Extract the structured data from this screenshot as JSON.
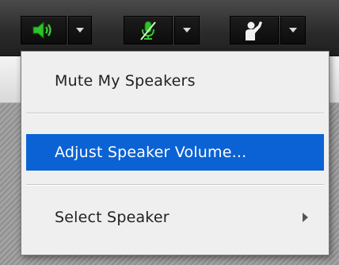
{
  "toolbar": {
    "speaker_icon": "speaker-icon",
    "microphone_icon": "microphone-muted-icon",
    "raise_hand_icon": "raise-hand-icon",
    "dropdown_icon": "chevron-down-icon",
    "accent_color": "#35c82e"
  },
  "menu": {
    "items": [
      {
        "label": "Mute My Speakers"
      },
      {
        "label": "Adjust Speaker Volume..."
      },
      {
        "label": "Select Speaker"
      }
    ],
    "selected_index": 1,
    "selection_color": "#0b62d4"
  }
}
